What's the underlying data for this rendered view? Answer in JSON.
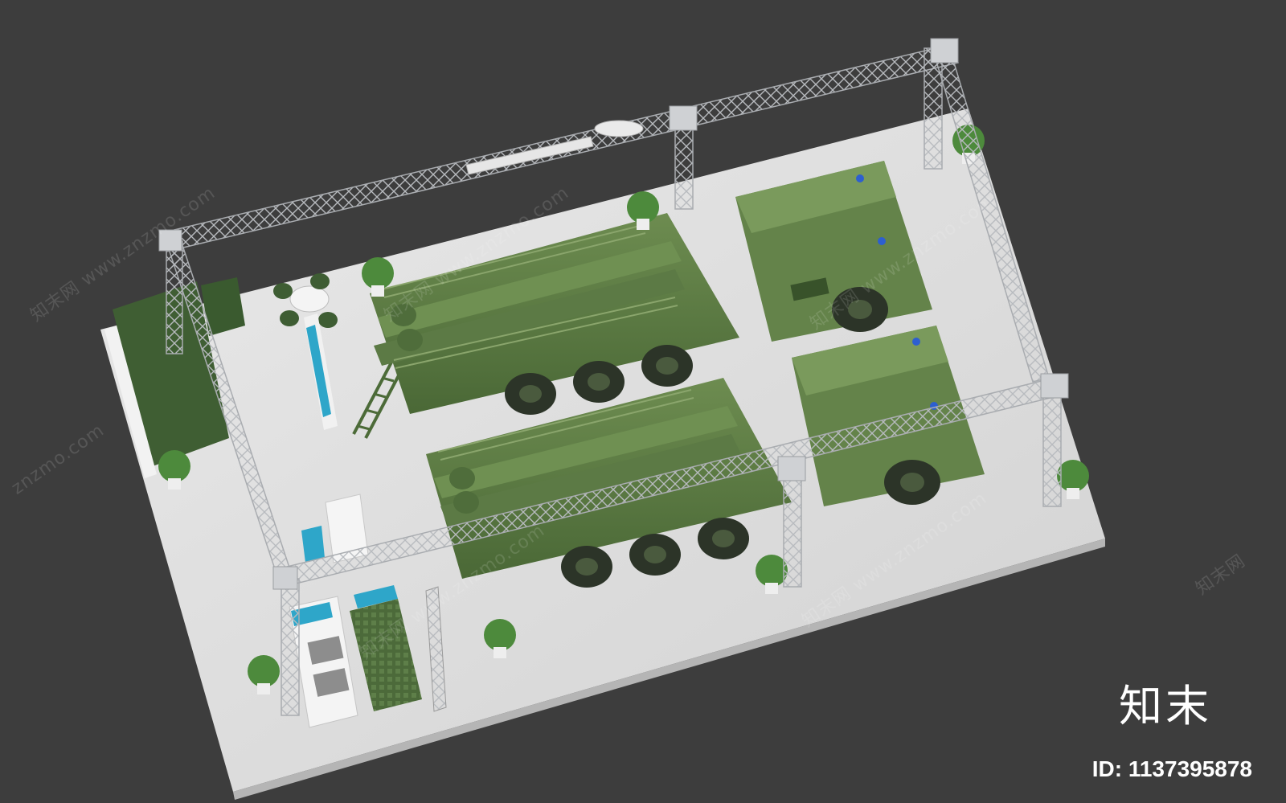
{
  "watermark": {
    "site_cn": "知末网",
    "site_url": "www.znzmo.com",
    "site_url_short": "znzmo.com"
  },
  "brand": {
    "name": "知末",
    "id_text": "ID: 1137395878"
  },
  "colors": {
    "background": "#3d3d3d",
    "floor": "#dedede",
    "truss": "#c6c8cc",
    "vehicle": "#5f7d44",
    "vehicle_dark": "#3f5a2e",
    "screen": "#2ea6c9",
    "plant": "#4d8a3c"
  }
}
